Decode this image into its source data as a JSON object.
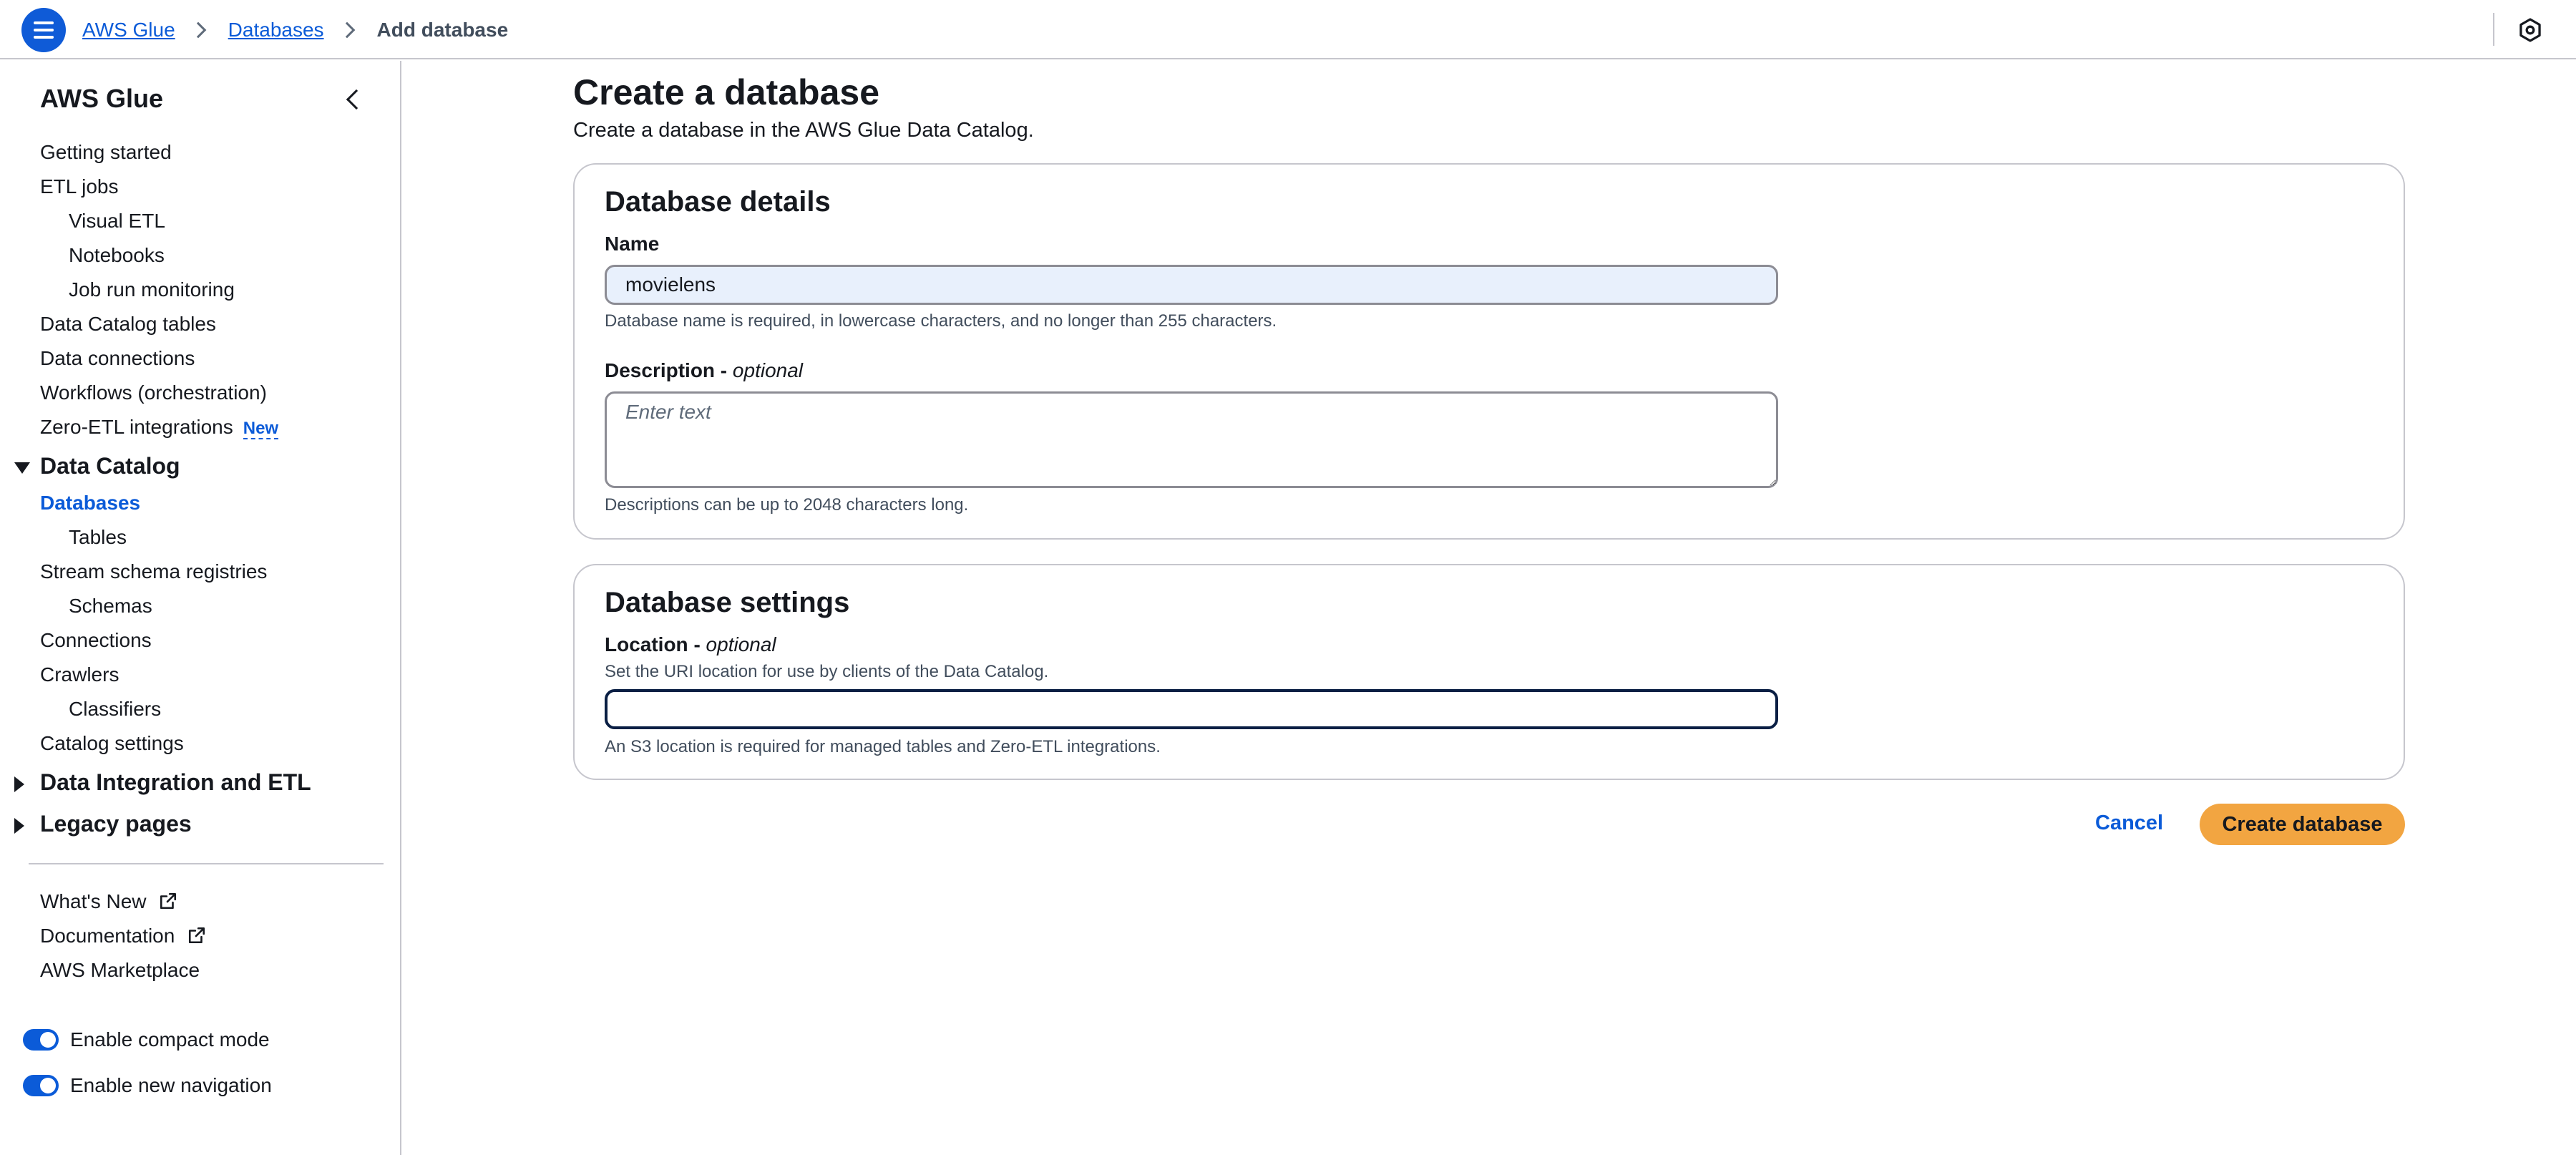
{
  "header": {
    "breadcrumb": [
      "AWS Glue",
      "Databases",
      "Add database"
    ]
  },
  "sidebar": {
    "title": "AWS Glue",
    "items": [
      "Getting started",
      "ETL jobs",
      "Visual ETL",
      "Notebooks",
      "Job run monitoring",
      "Data Catalog tables",
      "Data connections",
      "Workflows (orchestration)",
      "Zero-ETL integrations"
    ],
    "new_badge": "New",
    "data_catalog": {
      "label": "Data Catalog",
      "items": [
        "Databases",
        "Tables",
        "Stream schema registries",
        "Schemas",
        "Connections",
        "Crawlers",
        "Classifiers",
        "Catalog settings"
      ]
    },
    "sections": [
      "Data Integration and ETL",
      "Legacy pages"
    ],
    "footer_links": [
      "What's New",
      "Documentation",
      "AWS Marketplace"
    ],
    "toggles": {
      "compact_mode": "Enable compact mode",
      "new_navigation": "Enable new navigation"
    }
  },
  "main": {
    "title": "Create a database",
    "subtitle": "Create a database in the AWS Glue Data Catalog.",
    "details": {
      "heading": "Database details",
      "name_label": "Name",
      "name_value": "movielens",
      "name_hint": "Database name is required, in lowercase characters, and no longer than 255 characters.",
      "description_label": "Description - ",
      "description_optional": "optional",
      "description_placeholder": "Enter text",
      "description_hint": "Descriptions can be up to 2048 characters long."
    },
    "settings": {
      "heading": "Database settings",
      "location_label": "Location - ",
      "location_optional": "optional",
      "location_description": "Set the URI location for use by clients of the Data Catalog.",
      "location_value": "",
      "location_hint": "An S3 location is required for managed tables and Zero-ETL integrations."
    },
    "actions": {
      "cancel": "Cancel",
      "create": "Create database"
    }
  },
  "colors": {
    "link": "#0b5bd8",
    "primary_button": "#f2a541",
    "menu_button": "#0f5bd7"
  }
}
